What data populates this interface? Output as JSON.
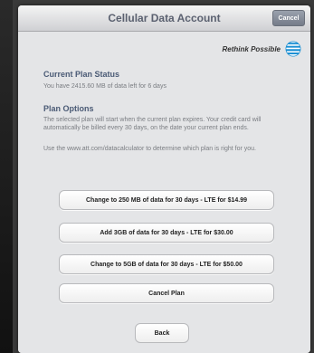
{
  "dialog": {
    "title": "Cellular Data Account",
    "cancel_label": "Cancel"
  },
  "brand": {
    "text": "Rethink Possible",
    "icon": "att-globe-icon"
  },
  "status": {
    "heading": "Current Plan Status",
    "text": "You have 2415.60 MB of data left for 6 days"
  },
  "options": {
    "heading": "Plan Options",
    "description": "The selected plan will start when the current plan expires. Your credit card will automatically be billed every 30 days, on the date your current plan ends.",
    "calculator_note": "Use the www.att.com/datacalculator to determine which plan is right for you.",
    "buttons": [
      "Change to 250 MB of data for 30 days - LTE for $14.99",
      "Add 3GB of data for 30 days - LTE for $30.00",
      "Change to 5GB of data for 30 days - LTE for $50.00",
      "Cancel Plan"
    ]
  },
  "footer": {
    "back_label": "Back"
  },
  "colors": {
    "heading": "#4a5a75",
    "body_text": "#7a7d82",
    "att_blue": "#1a8fd3"
  }
}
